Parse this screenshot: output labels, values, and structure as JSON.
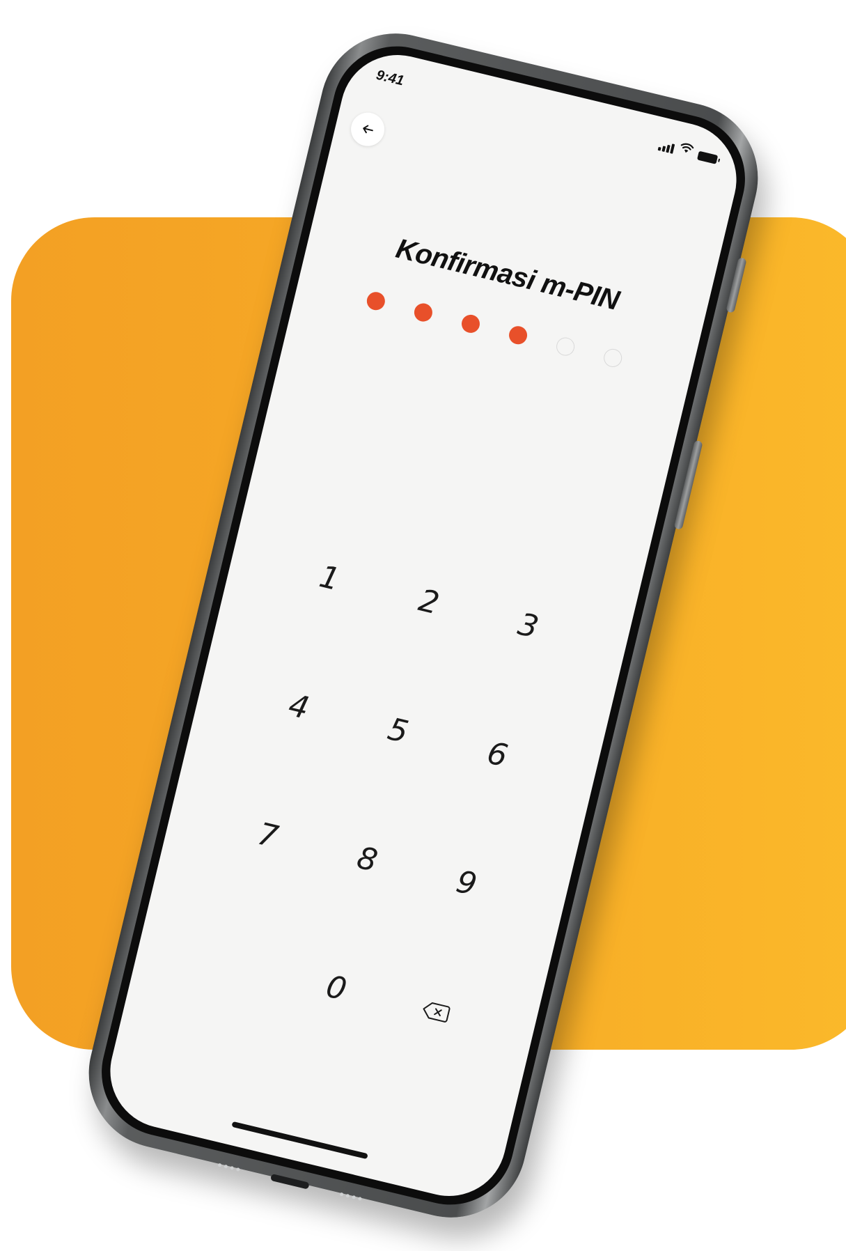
{
  "status_bar": {
    "time": "9:41"
  },
  "header": {
    "title": "Konfirmasi m-PIN"
  },
  "pin": {
    "length": 6,
    "entered": 4,
    "filled_color": "#e8502a",
    "empty_color": "#d9d9d9"
  },
  "keypad": {
    "keys": [
      "1",
      "2",
      "3",
      "4",
      "5",
      "6",
      "7",
      "8",
      "9",
      "",
      "0",
      "delete"
    ]
  },
  "icons": {
    "back": "arrow-left-icon",
    "delete": "backspace-icon",
    "signal": "cellular-signal-icon",
    "wifi": "wifi-icon",
    "battery": "battery-icon"
  },
  "colors": {
    "backdrop_start": "#f3a024",
    "backdrop_end": "#fbb92a",
    "screen_background": "#f5f5f4"
  }
}
